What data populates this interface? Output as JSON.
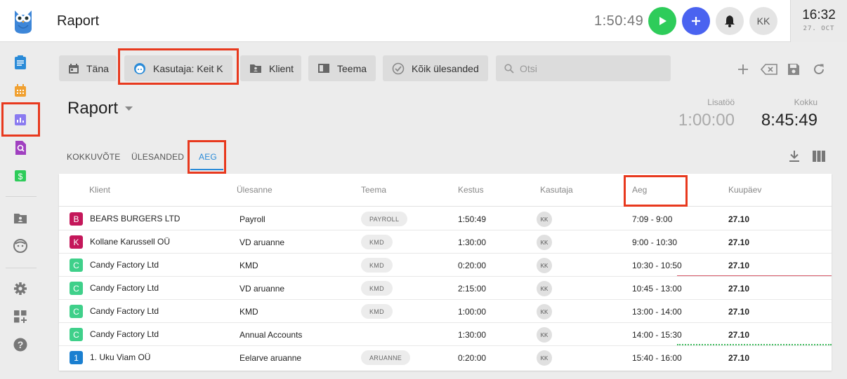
{
  "header": {
    "title": "Raport",
    "timer": "1:50:49",
    "user_initials": "KK",
    "clock_time": "16:32",
    "clock_date": "27. OCT"
  },
  "sidebar": {
    "items": [
      {
        "icon": "clipboard-icon",
        "color": "#2a8bd8"
      },
      {
        "icon": "calendar-icon",
        "color": "#f0a030"
      },
      {
        "icon": "report-chart-icon",
        "color": "#8a7af0",
        "active": true
      },
      {
        "icon": "search-report-icon",
        "color": "#a040c0"
      },
      {
        "icon": "dollar-icon",
        "color": "#2ecc5a"
      },
      {
        "icon": "client-folder-icon",
        "color": "#777"
      },
      {
        "icon": "user-face-icon",
        "color": "#777"
      },
      {
        "icon": "gear-icon",
        "color": "#777"
      },
      {
        "icon": "add-widget-icon",
        "color": "#777"
      },
      {
        "icon": "help-icon",
        "color": "#777"
      }
    ]
  },
  "filters": {
    "today": "Täna",
    "user": "Kasutaja: Keit K",
    "client": "Klient",
    "topic": "Teema",
    "all_tasks": "Kõik ülesanded",
    "search_placeholder": "Otsi"
  },
  "report": {
    "title": "Raport",
    "extra_label": "Lisatöö",
    "extra_value": "1:00:00",
    "total_label": "Kokku",
    "total_value": "8:45:49"
  },
  "tabs": {
    "summary": "KOKKUVÕTE",
    "tasks": "ÜLESANDED",
    "time": "AEG"
  },
  "table": {
    "columns": {
      "client": "Klient",
      "task": "Ülesanne",
      "topic": "Teema",
      "duration": "Kestus",
      "user": "Kasutaja",
      "time": "Aeg",
      "date": "Kuupäev"
    },
    "rows": [
      {
        "badge": "B",
        "badge_color": "#c4175a",
        "client": "BEARS BURGERS LTD",
        "task": "Payroll",
        "topic": "PAYROLL",
        "duration": "1:50:49",
        "user": "KK",
        "time": "7:09 - 9:00",
        "date": "27.10"
      },
      {
        "badge": "K",
        "badge_color": "#c4175a",
        "client": "Kollane Karussell OÜ",
        "task": "VD aruanne",
        "topic": "KMD",
        "duration": "1:30:00",
        "user": "KK",
        "time": "9:00 - 10:30",
        "date": "27.10"
      },
      {
        "badge": "C",
        "badge_color": "#3fd08a",
        "client": "Candy Factory Ltd",
        "task": "KMD",
        "topic": "KMD",
        "duration": "0:20:00",
        "user": "KK",
        "time": "10:30 - 10:50",
        "date": "27.10"
      },
      {
        "badge": "C",
        "badge_color": "#3fd08a",
        "client": "Candy Factory Ltd",
        "task": "VD aruanne",
        "topic": "KMD",
        "duration": "2:15:00",
        "user": "KK",
        "time": "10:45 - 13:00",
        "date": "27.10"
      },
      {
        "badge": "C",
        "badge_color": "#3fd08a",
        "client": "Candy Factory Ltd",
        "task": "KMD",
        "topic": "KMD",
        "duration": "1:00:00",
        "user": "KK",
        "time": "13:00 - 14:00",
        "date": "27.10"
      },
      {
        "badge": "C",
        "badge_color": "#3fd08a",
        "client": "Candy Factory Ltd",
        "task": "Annual Accounts",
        "topic": "",
        "duration": "1:30:00",
        "user": "KK",
        "time": "14:00 - 15:30",
        "date": "27.10"
      },
      {
        "badge": "1",
        "badge_color": "#1a7fd0",
        "client": "1. Uku Viam OÜ",
        "task": "Eelarve aruanne",
        "topic": "ARUANNE",
        "duration": "0:20:00",
        "user": "KK",
        "time": "15:40 - 16:00",
        "date": "27.10"
      }
    ]
  }
}
